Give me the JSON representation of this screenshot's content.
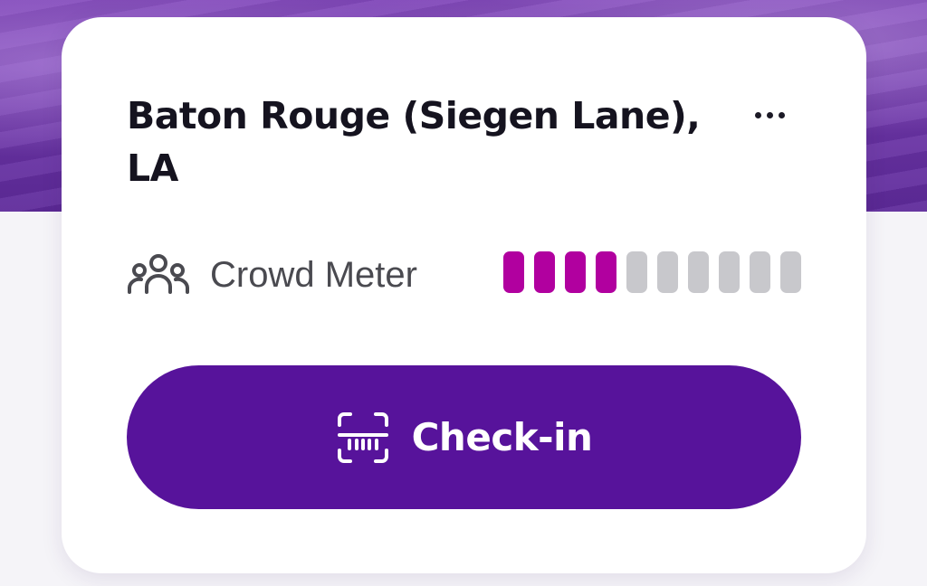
{
  "location": {
    "title": "Baton Rouge (Siegen Lane), LA",
    "more_icon": "more-horizontal-icon"
  },
  "crowd_meter": {
    "label": "Crowd Meter",
    "icon": "people-group-icon",
    "level": 4,
    "max": 10,
    "active_color": "#b1009f",
    "inactive_color": "#c8c8cc"
  },
  "checkin": {
    "label": "Check-in",
    "icon": "barcode-scan-icon",
    "bg_color": "#57139b"
  }
}
